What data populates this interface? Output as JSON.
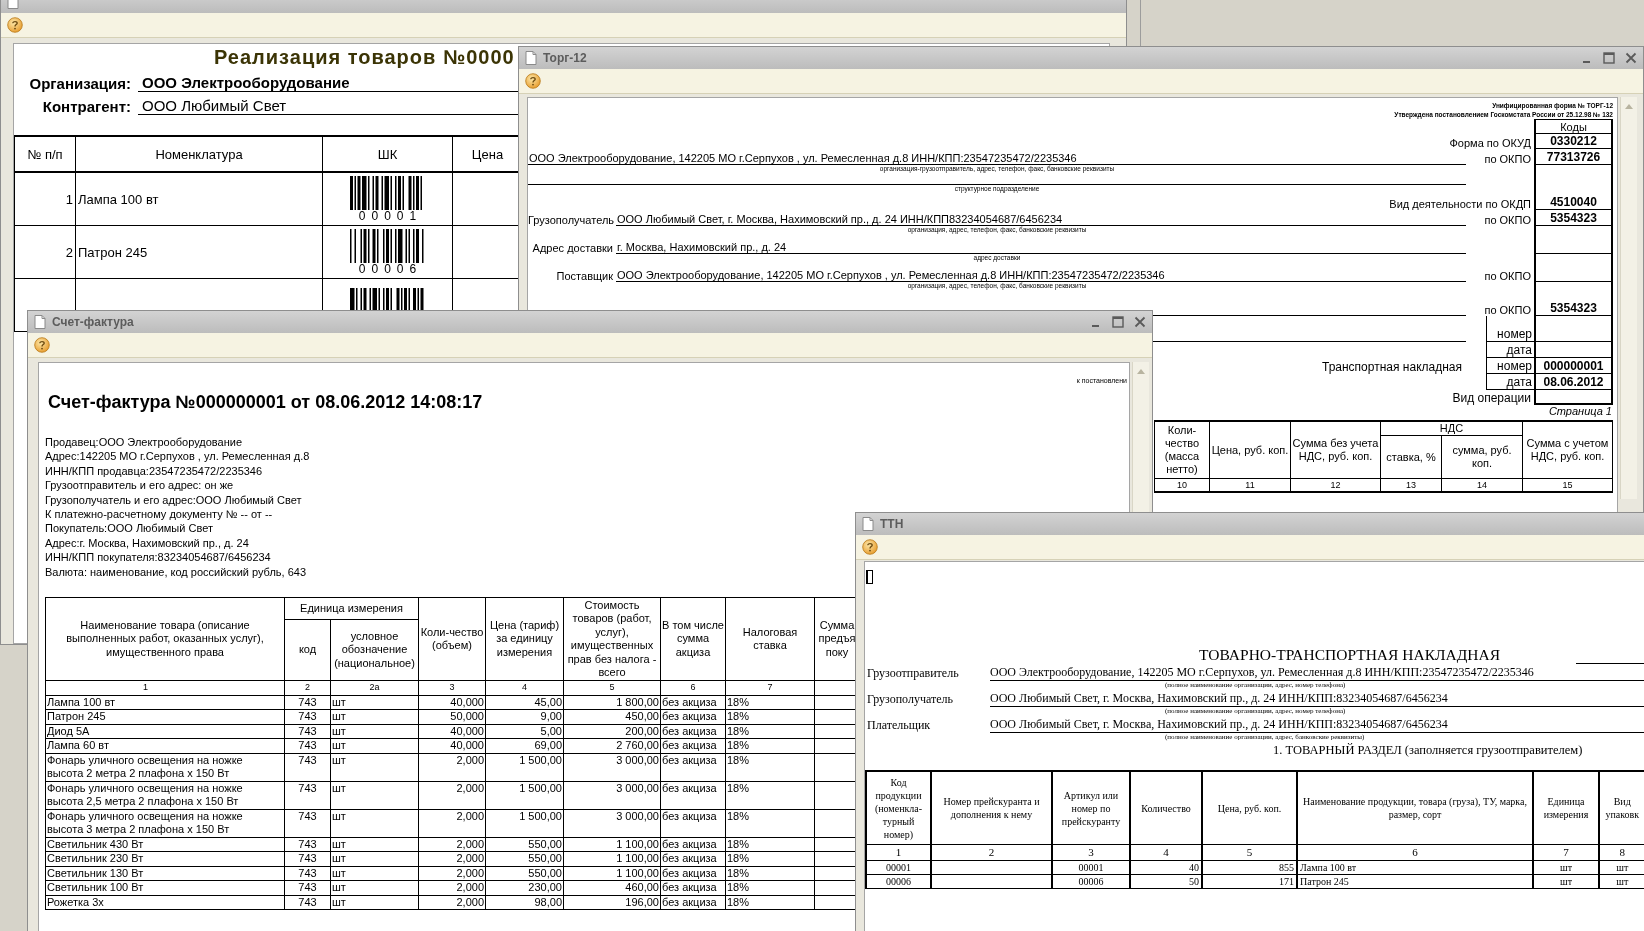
{
  "realization_window": {
    "heading": "Реализация товаров №0000",
    "fields": [
      {
        "label": "Организация:",
        "value": "ООО Электрооборудование",
        "bold": true
      },
      {
        "label": "Контрагент:",
        "value": "ООО Любимый Свет",
        "bold": false
      }
    ],
    "columns": [
      "№ п/п",
      "Номенклатура",
      "ШК",
      "Цена"
    ],
    "rows": [
      {
        "number": "1",
        "item": "Лампа 100 вт",
        "barcode": "00001"
      },
      {
        "number": "2",
        "item": "Патрон 245",
        "barcode": "00006"
      }
    ]
  },
  "torg12_window": {
    "title": "Торг-12",
    "form_note": [
      "Унифицированная форма № ТОРГ-12",
      "Утверждена постановлением Госкомстата России от 25.12.98 № 132"
    ],
    "lines": [
      {
        "kind": "codes_header",
        "code": "Коды"
      },
      {
        "kind": "code",
        "label": "Форма по ОКУД",
        "code": "0330212"
      },
      {
        "kind": "party",
        "value": "ООО Электрооборудование, 142205 МО г.Серпухов , ул. Ремесленная д.8 ИНН/КПП:23547235472/2235346",
        "okpo_label": "по ОКПО",
        "code": "77313726"
      },
      {
        "kind": "caption",
        "text": "организация-грузоотправитель, адрес, телефон, факс, банковские реквизиты"
      },
      {
        "kind": "blank_field",
        "text": "структурное подразделение"
      },
      {
        "kind": "code",
        "label": "Вид деятельности по ОКДП",
        "code": "4510040"
      },
      {
        "kind": "party",
        "label": "Грузополучатель",
        "value": "ООО Любимый Свет, г. Москва, Нахимовский пр., д. 24  ИНН/КПП83234054687/6456234",
        "okpo_label": "по ОКПО",
        "code": "5354323"
      },
      {
        "kind": "caption",
        "text": "организация, адрес, телефон, факс, банковские реквизиты"
      },
      {
        "kind": "party",
        "label": "Адрес доставки",
        "value": "г. Москва, Нахимовский пр., д. 24"
      },
      {
        "kind": "caption",
        "text": "адрес доставки"
      },
      {
        "kind": "party",
        "label": "Поставщик",
        "value": "ООО Электрооборудование, 142205 МО г.Серпухов , ул. Ремесленная д.8 ИНН/КПП:23547235472/2235346",
        "okpo_label": "по ОКПО"
      },
      {
        "kind": "caption",
        "text": "организация, адрес, телефон, факс, банковские реквизиты"
      },
      {
        "kind": "party",
        "okpo_label": "по ОКПО",
        "code": "5354323"
      },
      {
        "kind": "doc",
        "label": "номер"
      },
      {
        "kind": "doc",
        "label": "дата"
      },
      {
        "kind": "doc",
        "label": "номер",
        "code": "000000001",
        "title": "Транспортная накладная"
      },
      {
        "kind": "doc",
        "label": "дата",
        "code": "08.06.2012"
      },
      {
        "kind": "code",
        "label": "Вид операции"
      },
      {
        "kind": "page",
        "text": "Страница 1"
      }
    ],
    "table": {
      "group": "НДС",
      "columns": [
        {
          "label": "Коли-чество (масса нетто)",
          "number": "10",
          "grouped": false
        },
        {
          "label": "Цена, руб. коп.",
          "number": "11",
          "grouped": false
        },
        {
          "label": "Сумма без учета НДС, руб. коп.",
          "number": "12",
          "grouped": false
        },
        {
          "label": "ставка, %",
          "number": "13",
          "grouped": true
        },
        {
          "label": "сумма, руб. коп.",
          "number": "14",
          "grouped": true
        },
        {
          "label": "Сумма с учетом НДС, руб. коп.",
          "number": "15",
          "grouped": false
        }
      ]
    }
  },
  "invoice_window": {
    "title": "Счет-фактура",
    "note": "к постановлени",
    "heading": "Счет-фактура №000000001 от 08.06.2012 14:08:17",
    "info": [
      "Продавец:ООО Электрооборудование",
      "Адрес:142205 МО г.Серпухов , ул. Ремесленная д.8",
      "ИНН/КПП продавца:23547235472/2235346",
      "Грузоотправитель и его адрес: он же",
      "Грузополучатель и его адрес:ООО Любимый Свет",
      "К платежно-расчетному документу № -- от --",
      "Покупатель:ООО Любимый Свет",
      "Адрес:г. Москва, Нахимовский пр., д. 24",
      "ИНН/КПП покупателя:83234054687/6456234",
      "Валюта: наименование, код российский рубль, 643"
    ],
    "table": {
      "group": "Единица измерения",
      "columns": [
        {
          "label": "Наименование товара (описание выполненных работ, оказанных услуг), имущественного права",
          "number": "1",
          "grouped": false
        },
        {
          "label": "код",
          "number": "2",
          "grouped": true
        },
        {
          "label": "условное обозначение (национальное)",
          "number": "2а",
          "grouped": true
        },
        {
          "label": "Коли-чество (объем)",
          "number": "3",
          "grouped": false
        },
        {
          "label": "Цена (тариф) за единицу измерения",
          "number": "4",
          "grouped": false
        },
        {
          "label": "Стоимость товаров (работ, услуг), имущественных прав без налога - всего",
          "number": "5",
          "grouped": false
        },
        {
          "label": "В том числе сумма акциза",
          "number": "6",
          "grouped": false
        },
        {
          "label": "Налоговая ставка",
          "number": "7",
          "grouped": false
        },
        {
          "label": "Сумма предъя поку",
          "grouped": false
        }
      ],
      "rows": [
        {
          "cells": [
            "Лампа 100 вт",
            "743",
            "шт",
            "40,000",
            "45,00",
            "1 800,00",
            "без акциза",
            "18%"
          ]
        },
        {
          "cells": [
            "Патрон 245",
            "743",
            "шт",
            "50,000",
            "9,00",
            "450,00",
            "без акциза",
            "18%"
          ]
        },
        {
          "cells": [
            "Диод 5А",
            "743",
            "шт",
            "40,000",
            "5,00",
            "200,00",
            "без акциза",
            "18%"
          ]
        },
        {
          "cells": [
            "Лампа 60 вт",
            "743",
            "шт",
            "40,000",
            "69,00",
            "2 760,00",
            "без акциза",
            "18%"
          ]
        },
        {
          "cells": [
            "Фонарь уличного освещения на ножке высота 2 метра 2 плафона х 150 Вт",
            "743",
            "шт",
            "2,000",
            "1 500,00",
            "3 000,00",
            "без акциза",
            "18%"
          ]
        },
        {
          "cells": [
            "Фонарь уличного освещения на ножке высота 2,5 метра 2 плафона х 150 Вт",
            "743",
            "шт",
            "2,000",
            "1 500,00",
            "3 000,00",
            "без акциза",
            "18%"
          ]
        },
        {
          "cells": [
            "Фонарь уличного освещения на ножке высота 3 метра 2 плафона х 150 Вт",
            "743",
            "шт",
            "2,000",
            "1 500,00",
            "3 000,00",
            "без акциза",
            "18%"
          ]
        },
        {
          "cells": [
            "Светильник 430 Вт",
            "743",
            "шт",
            "2,000",
            "550,00",
            "1 100,00",
            "без акциза",
            "18%"
          ]
        },
        {
          "cells": [
            "Светильник 230 Вт",
            "743",
            "шт",
            "2,000",
            "550,00",
            "1 100,00",
            "без акциза",
            "18%"
          ]
        },
        {
          "cells": [
            "Светильник 130 Вт",
            "743",
            "шт",
            "2,000",
            "550,00",
            "1 100,00",
            "без акциза",
            "18%"
          ]
        },
        {
          "cells": [
            "Светильник 100 Вт",
            "743",
            "шт",
            "2,000",
            "230,00",
            "460,00",
            "без акциза",
            "18%"
          ]
        },
        {
          "cells": [
            "Рожетка 3х",
            "743",
            "шт",
            "2,000",
            "98,00",
            "196,00",
            "без акциза",
            "18%"
          ]
        }
      ]
    }
  },
  "ttn_window": {
    "title": "ТТН",
    "heading": "ТОВАРНО-ТРАНСПОРТНАЯ НАКЛАДНАЯ",
    "parties": [
      {
        "label": "Грузоотправитель",
        "value": "ООО Электрооборудование, 142205 МО г.Серпухов, ул. Ремесленная д.8 ИНН/КПП:23547235472/2235346",
        "caption": "(полное наименование организации, адрес, номер телефона)"
      },
      {
        "label": "Грузополучатель",
        "value": "ООО Любимый Свет, г. Москва, Нахимовский пр., д. 24  ИНН/КПП:83234054687/6456234",
        "caption": "(полное наименование организации, адрес, номер телефона)"
      },
      {
        "label": "Плательщик",
        "value": "ООО Любимый Свет, г. Москва, Нахимовский пр., д. 24  ИНН/КПП:83234054687/6456234",
        "caption": "(полное наименование организации, адрес, банковские реквизиты)"
      }
    ],
    "section": "1. ТОВАРНЫЙ РАЗДЕЛ (заполняется грузоотправителем)",
    "columns": [
      {
        "label": "Код продукции (номенкла-турный номер)",
        "number": "1"
      },
      {
        "label": "Номер прейскуранта и дополнения к нему",
        "number": "2"
      },
      {
        "label": "Артикул или номер по прейскуранту",
        "number": "3"
      },
      {
        "label": "Количество",
        "number": "4"
      },
      {
        "label": "Цена, руб. коп.",
        "number": "5"
      },
      {
        "label": "Наименование продукции, товара (груза), ТУ, марка, размер, сорт",
        "number": "6"
      },
      {
        "label": "Единица измерения",
        "number": "7"
      },
      {
        "label": "Вид упаковк",
        "number": "8"
      }
    ],
    "rows": [
      {
        "cells": [
          "00001",
          null,
          "00001",
          "40",
          "855",
          "Лампа 100 вт",
          "шт",
          "шт"
        ]
      },
      {
        "cells": [
          "00006",
          null,
          "00006",
          "50",
          "171",
          "Патрон 245",
          "шт",
          "шт"
        ]
      }
    ]
  }
}
